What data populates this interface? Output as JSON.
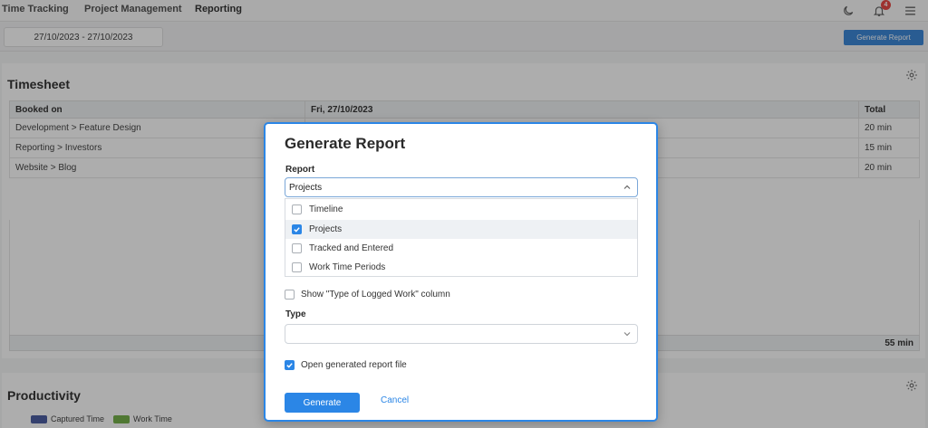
{
  "nav": {
    "items": [
      "Time Tracking",
      "Project Management",
      "Reporting"
    ],
    "notification_count": "4"
  },
  "toolbar": {
    "date_range": "27/10/2023 - 27/10/2023",
    "generate_report_label": "Generate Report"
  },
  "timesheet": {
    "title": "Timesheet",
    "columns": [
      "Booked on",
      "Fri, 27/10/2023",
      "Total"
    ],
    "rows": [
      {
        "booked_on": "Development > Feature Design",
        "day": "",
        "total": "20 min"
      },
      {
        "booked_on": "Reporting > Investors",
        "day": "",
        "total": "15 min"
      },
      {
        "booked_on": "Website > Blog",
        "day": "",
        "total": "20 min"
      }
    ],
    "grand_total": "55 min"
  },
  "productivity": {
    "title": "Productivity",
    "legend": [
      {
        "label": "Captured Time",
        "color": "#3d4f9a"
      },
      {
        "label": "Work Time",
        "color": "#6aaa3a"
      }
    ]
  },
  "modal": {
    "title": "Generate Report",
    "report_label": "Report",
    "report_value": "Projects",
    "report_options": [
      {
        "label": "Timeline",
        "checked": false
      },
      {
        "label": "Projects",
        "checked": true
      },
      {
        "label": "Tracked and Entered",
        "checked": false
      },
      {
        "label": "Work Time Periods",
        "checked": false
      }
    ],
    "show_type_column_label": "Show \"Type of Logged Work\" column",
    "show_type_column_checked": false,
    "type_label": "Type",
    "type_value": "",
    "open_file_label": "Open generated report file",
    "open_file_checked": true,
    "generate_label": "Generate",
    "cancel_label": "Cancel"
  },
  "colors": {
    "accent": "#2b86e6",
    "toolbar_button": "#2b7cd3",
    "badge": "#e53935"
  },
  "icons": {
    "theme": "moon-icon",
    "notifications": "bell-icon",
    "menu": "hamburger-menu-icon",
    "settings": "gear-icon",
    "dropdown": "chevron-icon",
    "checkbox": "check-icon"
  }
}
